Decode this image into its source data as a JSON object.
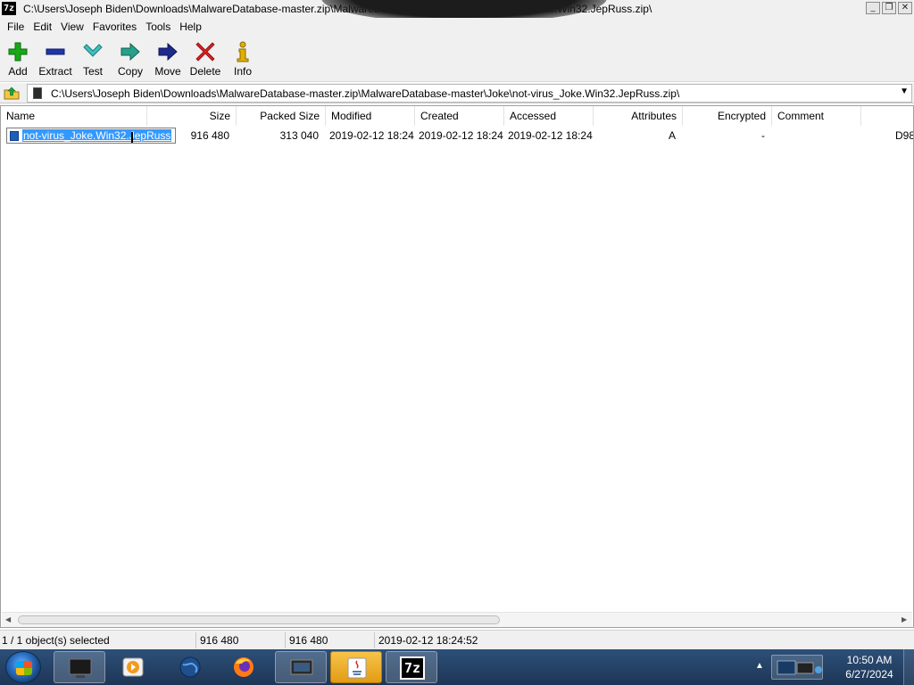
{
  "window": {
    "title": "C:\\Users\\Joseph Biden\\Downloads\\MalwareDatabase-master.zip\\MalwareDatabase-master\\Joke\\not-virus_Joke.Win32.JepRuss.zip\\",
    "app_icon_text": "7z"
  },
  "menu": [
    "File",
    "Edit",
    "View",
    "Favorites",
    "Tools",
    "Help"
  ],
  "toolbar": {
    "add": "Add",
    "extract": "Extract",
    "test": "Test",
    "copy": "Copy",
    "move": "Move",
    "delete": "Delete",
    "info": "Info"
  },
  "address": {
    "path": "C:\\Users\\Joseph Biden\\Downloads\\MalwareDatabase-master.zip\\MalwareDatabase-master\\Joke\\not-virus_Joke.Win32.JepRuss.zip\\"
  },
  "columns": [
    "Name",
    "Size",
    "Packed Size",
    "Modified",
    "Created",
    "Accessed",
    "Attributes",
    "Encrypted",
    "Comment"
  ],
  "files": [
    {
      "name": "not-virus_Joke.Win32.JepRuss",
      "size": "916 480",
      "packed_size": "313 040",
      "modified": "2019-02-12 18:24",
      "created": "2019-02-12 18:24",
      "accessed": "2019-02-12 18:24",
      "attributes": "A",
      "encrypted": "-",
      "comment": "",
      "overflow": "D98"
    }
  ],
  "status": {
    "selection": "1 / 1 object(s) selected",
    "size": "916 480",
    "packed": "916 480",
    "date": "2019-02-12 18:24:52"
  },
  "taskbar": {
    "time": "10:50 AM",
    "date": "6/27/2024",
    "sevenzip_label": "7z"
  },
  "colors": {
    "selection": "#3399ff",
    "taskbar": "#2d4f78",
    "add_green": "#18a818",
    "delete_red": "#d62020",
    "move_navy": "#1c2a8c"
  }
}
